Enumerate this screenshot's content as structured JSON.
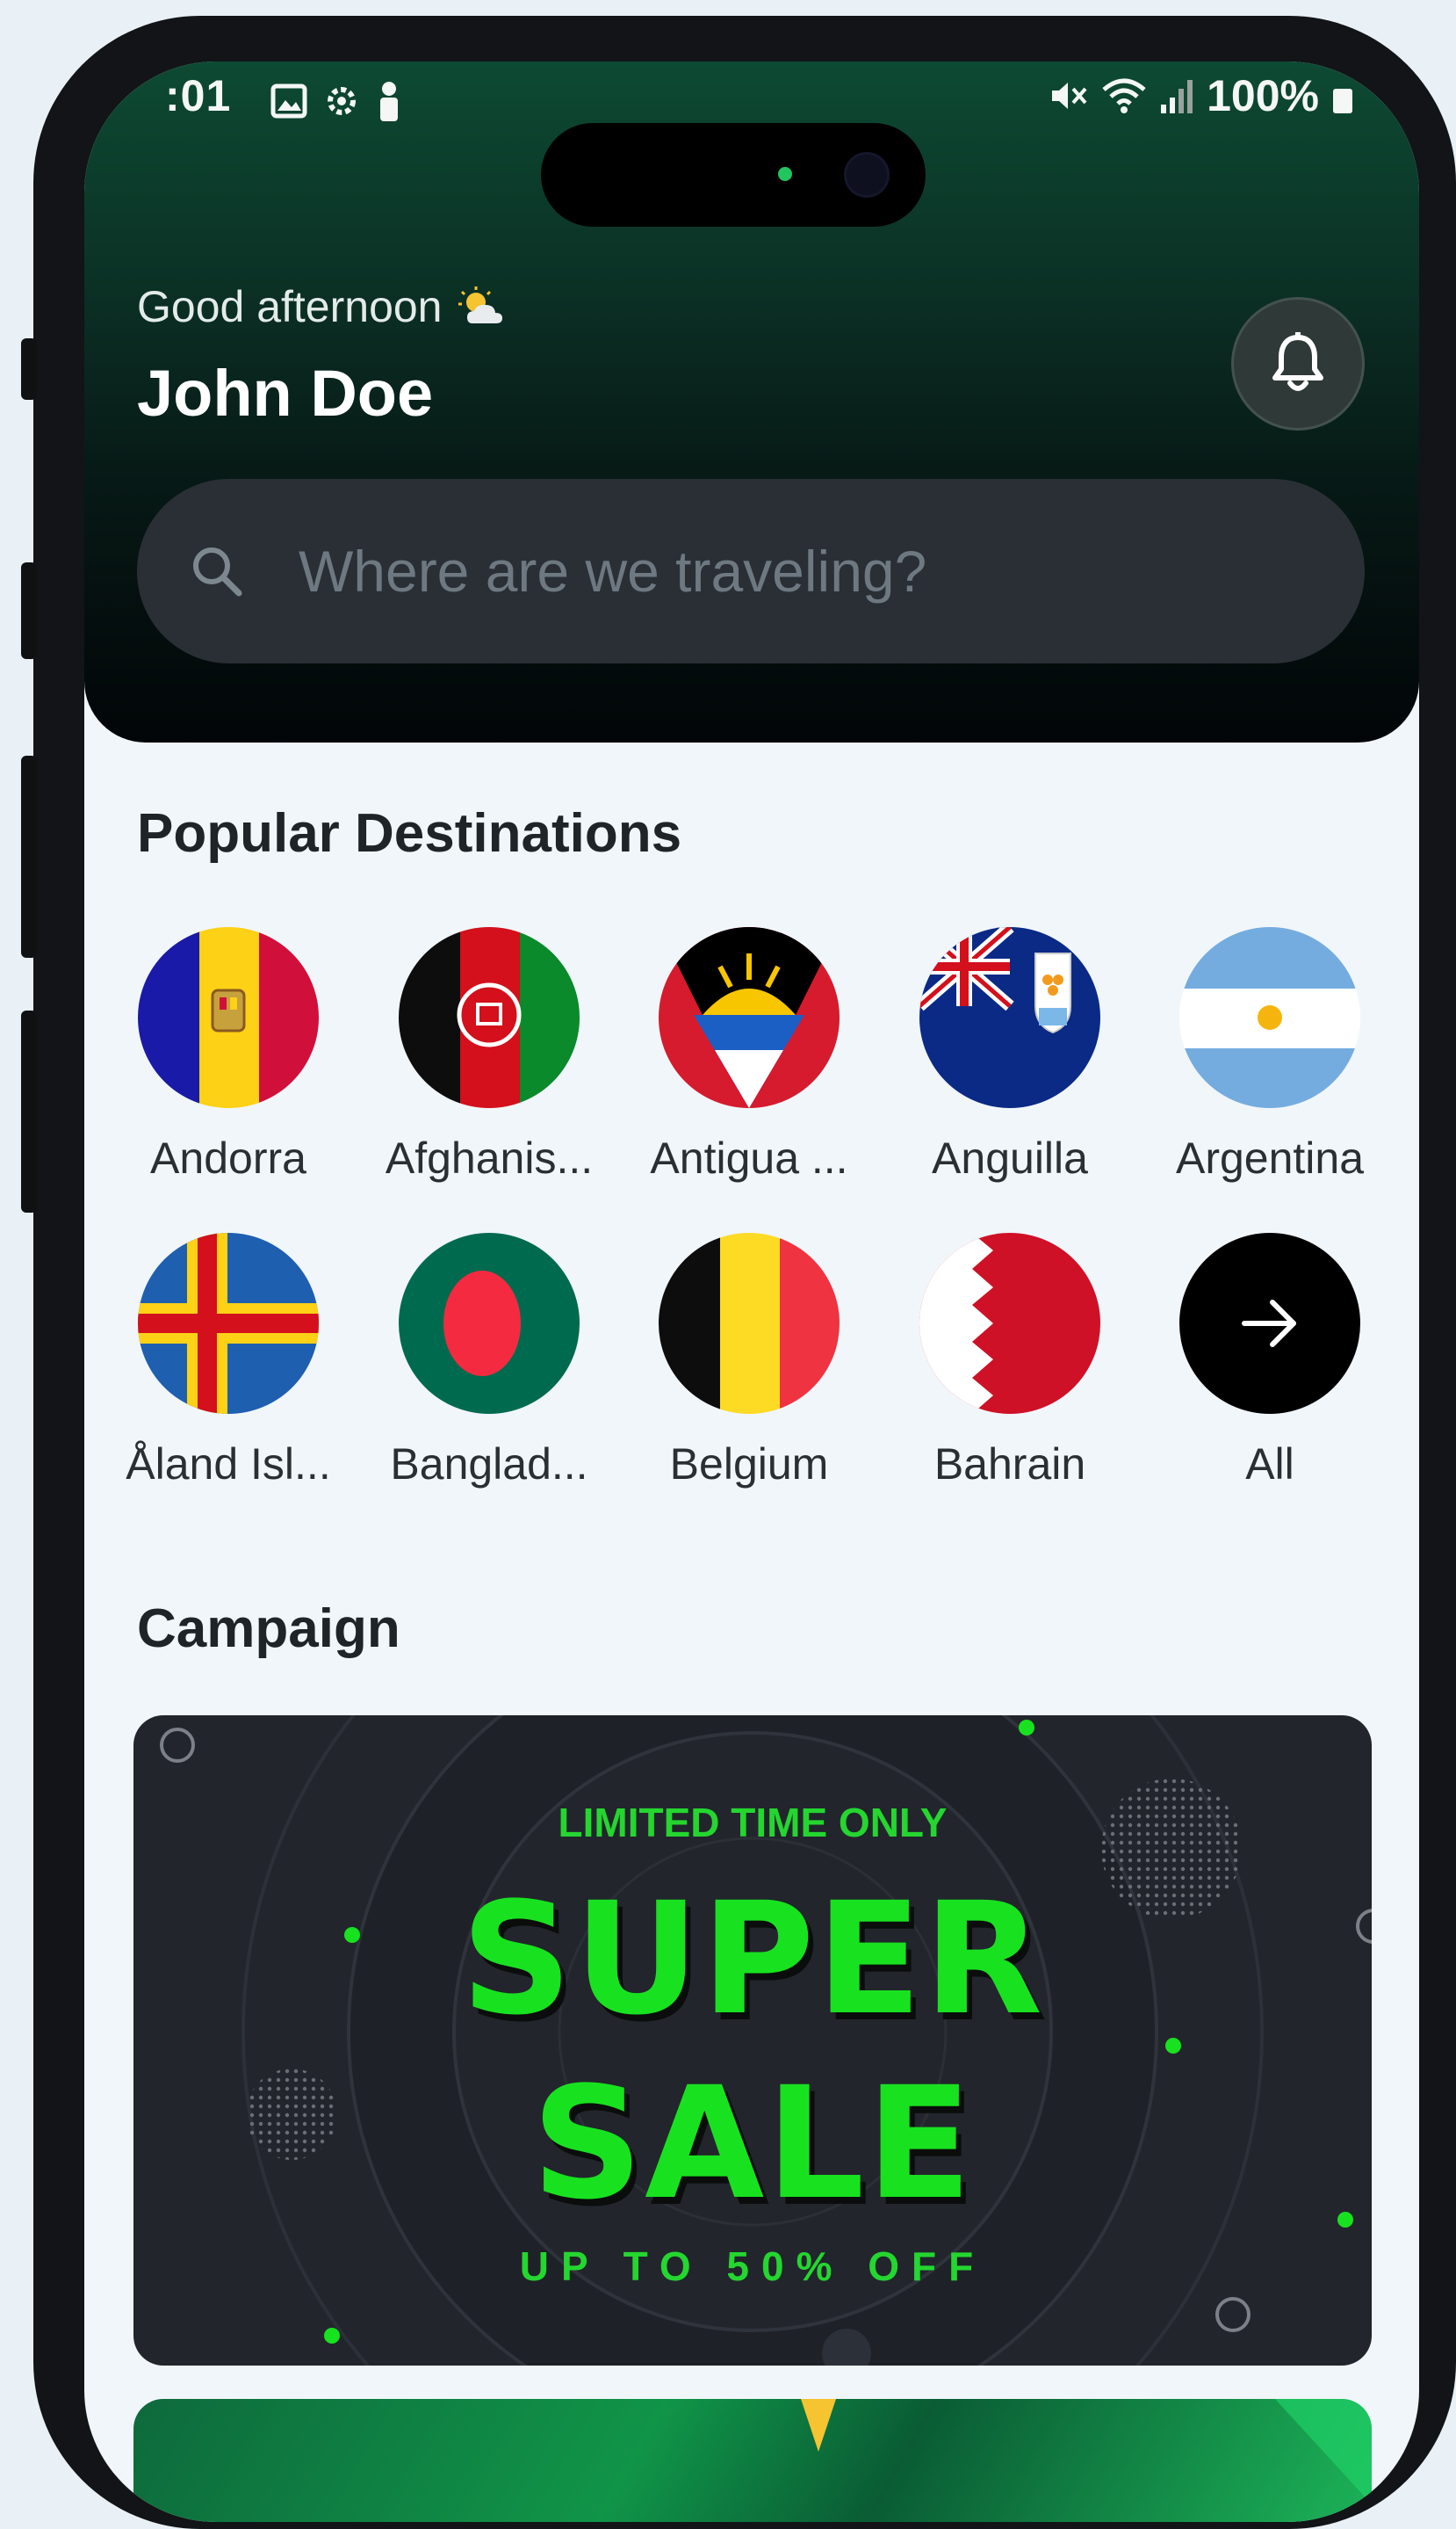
{
  "status_bar": {
    "time": ":01",
    "battery": "100%"
  },
  "header": {
    "greeting": "Good afternoon",
    "user_name": "John Doe"
  },
  "search": {
    "placeholder": "Where are we traveling?"
  },
  "popular": {
    "title": "Popular Destinations",
    "items": [
      {
        "label": "Andorra"
      },
      {
        "label": "Afghanis..."
      },
      {
        "label": "Antigua ..."
      },
      {
        "label": "Anguilla"
      },
      {
        "label": "Argentina"
      },
      {
        "label": "Åland Isl..."
      },
      {
        "label": "Banglad..."
      },
      {
        "label": "Belgium"
      },
      {
        "label": "Bahrain"
      },
      {
        "label": "All"
      }
    ]
  },
  "campaign": {
    "title": "Campaign",
    "banner": {
      "line1": "LIMITED TIME ONLY",
      "line2": "SUPER",
      "line3": "SALE",
      "line4": "UP TO 50% OFF"
    }
  },
  "colors": {
    "accent_green": "#18e220",
    "header_dark": "#071a16",
    "background": "#f1f6fb"
  }
}
